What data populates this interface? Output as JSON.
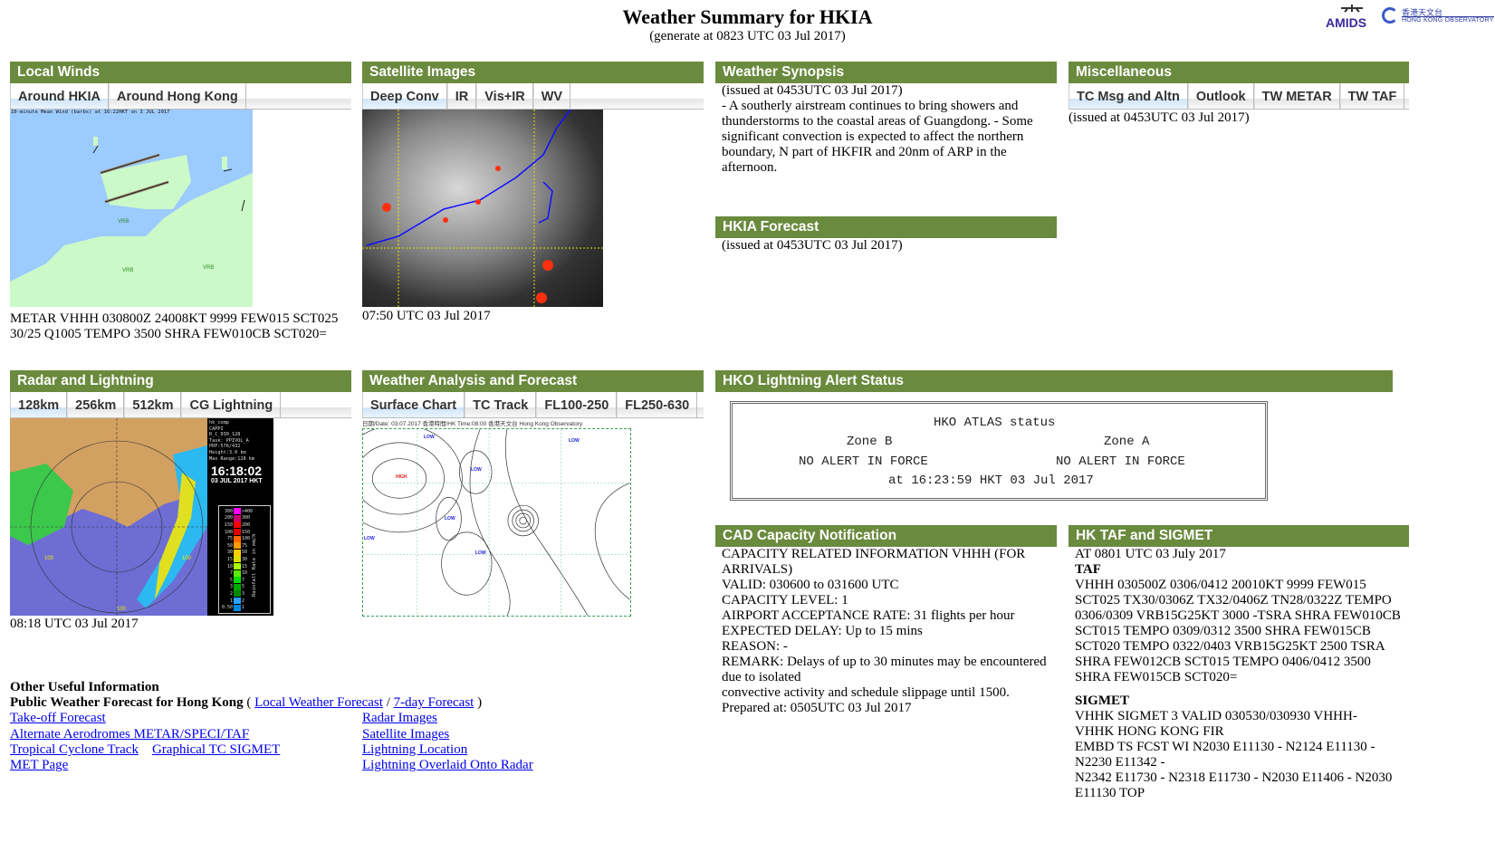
{
  "header": {
    "title": "Weather Summary for HKIA",
    "subtitle": "(generate at 0823 UTC 03 Jul 2017)",
    "logo_amids": "AMIDS",
    "logo_hko_cn": "香港天文台",
    "logo_hko_en": "HONG KONG OBSERVATORY"
  },
  "local_winds": {
    "title": "Local Winds",
    "tabs": [
      {
        "label": "Around HKIA",
        "active": true
      },
      {
        "label": "Around Hong Kong",
        "active": false
      }
    ],
    "image_caption": "10-minute Mean Wind (barbs) at 16:22HKT on 3 JUL 2017",
    "map_labels": [
      "VRB",
      "VRB",
      "VRB"
    ],
    "metar": "METAR VHHH 030800Z 24008KT 9999 FEW015 SCT025 30/25 Q1005 TEMPO 3500 SHRA FEW010CB SCT020="
  },
  "satellite": {
    "title": "Satellite Images",
    "tabs": [
      {
        "label": "Deep Conv",
        "active": true
      },
      {
        "label": "IR"
      },
      {
        "label": "Vis+IR"
      },
      {
        "label": "WV"
      }
    ],
    "timestamp": "07:50 UTC 03 Jul 2017"
  },
  "synopsis": {
    "title": "Weather Synopsis",
    "issued": "(issued at 0453UTC 03 Jul 2017)",
    "text": "- A southerly airstream continues to bring showers and thunderstorms to the coastal areas of Guangdong. - Some significant convection is expected to affect the northern boundary, N part of HKFIR and 20nm of ARP in the afternoon."
  },
  "hkia_forecast": {
    "title": "HKIA Forecast",
    "issued": "(issued at 0453UTC 03 Jul 2017)"
  },
  "misc": {
    "title": "Miscellaneous",
    "tabs": [
      {
        "label": "TC Msg and Altn",
        "active": true
      },
      {
        "label": "Outlook"
      },
      {
        "label": "TW METAR"
      },
      {
        "label": "TW TAF"
      }
    ],
    "issued": "(issued at 0453UTC 03 Jul 2017)"
  },
  "radar": {
    "title": "Radar and Lightning",
    "tabs": [
      {
        "label": "128km",
        "active": true
      },
      {
        "label": "256km"
      },
      {
        "label": "512km"
      },
      {
        "label": "CG Lightning"
      }
    ],
    "info_lines": [
      "hk_comp",
      "CAPPI",
      "R_C_030_128",
      "Task: PPIVOL_A",
      "PRF:576/432",
      "Height:3.0 km",
      "Max Range:128 km"
    ],
    "clock": "16:18:02",
    "date": "03 JUL 2017 HKT",
    "legend_left": [
      "300",
      "200",
      "150",
      "100",
      "75",
      "50",
      "30",
      "15",
      "10",
      "7",
      "5",
      "3",
      "2",
      "1",
      "0.50"
    ],
    "legend_right": [
      ">400",
      "300",
      "200",
      "150",
      "100",
      "75",
      "50",
      "30",
      "15",
      "10",
      "7",
      "5",
      "3",
      "2",
      "1"
    ],
    "legend_colors": [
      "#ff00ff",
      "#c8006e",
      "#ff0000",
      "#e00000",
      "#ff6600",
      "#ff9900",
      "#ffcc00",
      "#dddd00",
      "#aaff00",
      "#55ee00",
      "#00dd00",
      "#00aa00",
      "#008800",
      "#2aa0ff",
      "#0088dd"
    ],
    "legend_title": "Rainfall Rate in mm/h",
    "range_labels": [
      "100",
      "100",
      "100"
    ],
    "timestamp": "08:18 UTC 03 Jul 2017"
  },
  "analysis": {
    "title": "Weather Analysis and Forecast",
    "tabs": [
      {
        "label": "Surface Chart",
        "active": true
      },
      {
        "label": "TC Track"
      },
      {
        "label": "FL100-250"
      },
      {
        "label": "FL250-630"
      }
    ],
    "chart_header": "日期/Date: 03.07.2017   香港時間/HK Time:08:00   香港天文台 Hong Kong Observatory",
    "pressure_labels": [
      "LOW",
      "HIGH",
      "LOW",
      "LOW",
      "LOW",
      "LOW",
      "LOW"
    ]
  },
  "lightning": {
    "title": "HKO Lightning Alert Status",
    "atlas_title": "HKO ATLAS status",
    "zone_b": "Zone B",
    "zone_a": "Zone A",
    "zone_b_status": "NO ALERT IN FORCE",
    "zone_a_status": "NO ALERT IN FORCE",
    "time": "at 16:23:59 HKT 03 Jul 2017"
  },
  "cad": {
    "title": "CAD Capacity Notification",
    "lines": [
      "CAPACITY RELATED INFORMATION VHHH (FOR ARRIVALS)",
      "VALID: 030600 to 031600 UTC",
      "CAPACITY LEVEL: 1",
      "AIRPORT ACCEPTANCE RATE: 31 flights per hour",
      "EXPECTED DELAY: Up to 15 mins",
      "REASON: -",
      "REMARK: Delays of up to 30 minutes may be encountered due to isolated",
      "convective activity and schedule slippage until 1500.",
      "Prepared at: 0505UTC 03 Jul 2017"
    ]
  },
  "taf": {
    "title": "HK TAF and SIGMET",
    "at": "AT 0801 UTC 03 July 2017",
    "taf_heading": "TAF",
    "taf_text": "VHHH 030500Z 0306/0412 20010KT 9999 FEW015 SCT025 TX30/0306Z TX32/0406Z TN28/0322Z TEMPO 0306/0309 VRB15G25KT 3000 -TSRA SHRA FEW010CB SCT015 TEMPO 0309/0312 3500 SHRA FEW015CB SCT020 TEMPO 0322/0403 VRB15G25KT 2500 TSRA SHRA FEW012CB SCT015 TEMPO 0406/0412 3500 SHRA FEW015CB SCT020=",
    "sigmet_heading": "SIGMET",
    "sigmet_lines": [
      "VHHK SIGMET 3 VALID 030530/030930 VHHH-",
      "VHHK HONG KONG FIR",
      "EMBD TS FCST WI N2030 E11130 - N2124 E11130 - N2230 E11342 -",
      "N2342 E11730 - N2318 E11730 - N2030 E11406 - N2030 E11130 TOP"
    ]
  },
  "other": {
    "heading": "Other Useful Information",
    "public_label": "Public Weather Forecast for Hong Kong",
    "open_paren": " ( ",
    "sep": " / ",
    "close_paren": " )",
    "local_forecast": "Local Weather Forecast",
    "seven_day": "7-day Forecast",
    "left_links": [
      "Take-off Forecast",
      "Alternate Aerodromes METAR/SPECI/TAF",
      "Tropical Cyclone Track",
      "MET Page"
    ],
    "graphical_tc": "Graphical TC SIGMET",
    "right_links": [
      "Radar Images",
      "Satellite Images",
      "Lightning Location",
      "Lightning Overlaid Onto Radar"
    ]
  }
}
